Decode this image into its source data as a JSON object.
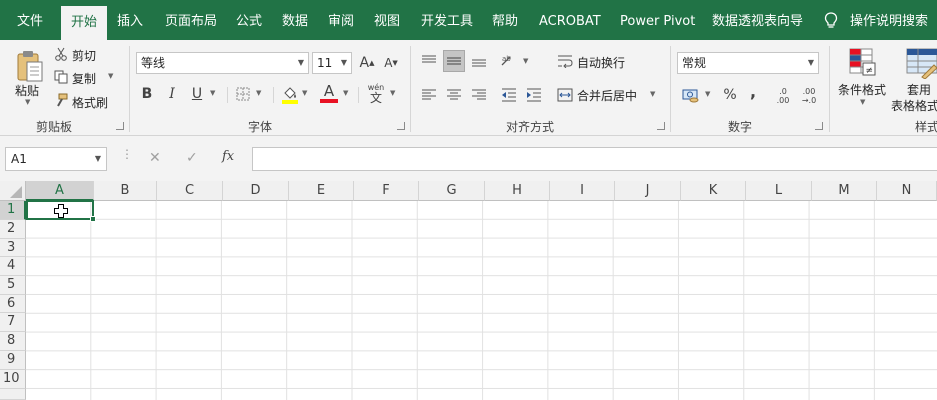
{
  "tabs": [
    "文件",
    "开始",
    "插入",
    "页面布局",
    "公式",
    "数据",
    "审阅",
    "视图",
    "开发工具",
    "帮助",
    "ACROBAT",
    "Power Pivot",
    "数据透视表向导",
    "操作说明搜索"
  ],
  "clipboard": {
    "paste": "粘贴",
    "cut": "剪切",
    "copy": "复制",
    "format_painter": "格式刷",
    "group": "剪贴板"
  },
  "font": {
    "name": "等线",
    "size": "11",
    "grow": "A",
    "shrink": "A",
    "bold": "B",
    "italic": "I",
    "underline": "U",
    "font_color_letter": "A",
    "phonetic": "文",
    "group": "字体"
  },
  "alignment": {
    "wrap_text": "自动换行",
    "merge_center": "合并后居中",
    "group": "对齐方式"
  },
  "number": {
    "format": "常规",
    "percent": "%",
    "comma": ",",
    "inc_decimal_top": ".0",
    "inc_decimal_bottom": ".00",
    "dec_decimal_top": ".00",
    "dec_decimal_bottom": "→.0",
    "group": "数字"
  },
  "styles": {
    "conditional": "条件格式",
    "table_format_line1": "套用",
    "table_format_line2": "表格格式",
    "group": "样式"
  },
  "formula_bar": {
    "name_box": "A1",
    "fx": "fx",
    "cancel": "✕",
    "enter": "✓",
    "value": ""
  },
  "columns": [
    "A",
    "B",
    "C",
    "D",
    "E",
    "F",
    "G",
    "H",
    "I",
    "J",
    "K",
    "L",
    "M",
    "N"
  ],
  "rows": [
    "1",
    "2",
    "3",
    "4",
    "5",
    "6",
    "7",
    "8",
    "9",
    "10"
  ],
  "colors": {
    "brand": "#217346",
    "font_color": "#e81123",
    "highlight": "#ffff00"
  }
}
